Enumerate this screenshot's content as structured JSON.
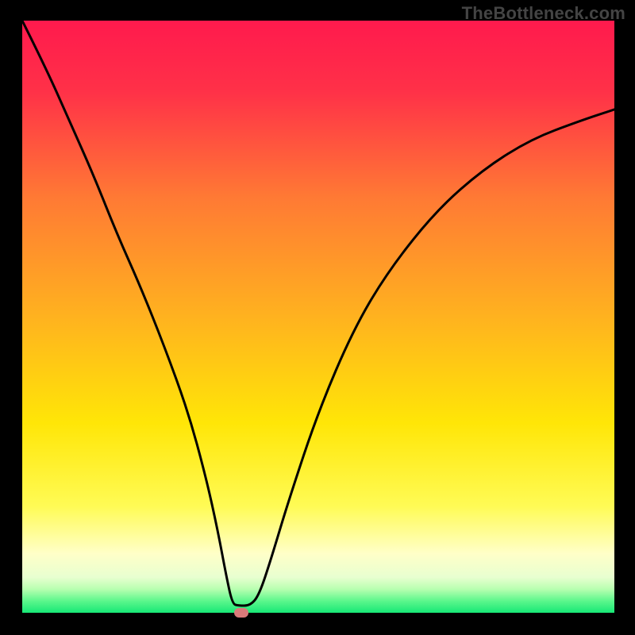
{
  "watermark": "TheBottleneck.com",
  "chart_data": {
    "type": "line",
    "title": "",
    "xlabel": "",
    "ylabel": "",
    "xlim": [
      0,
      100
    ],
    "ylim": [
      0,
      100
    ],
    "background_gradient_stops": [
      {
        "pct": 0,
        "color": "#ff1a4d"
      },
      {
        "pct": 12,
        "color": "#ff3148"
      },
      {
        "pct": 30,
        "color": "#ff7a34"
      },
      {
        "pct": 50,
        "color": "#ffb21f"
      },
      {
        "pct": 68,
        "color": "#ffe607"
      },
      {
        "pct": 82,
        "color": "#fffb55"
      },
      {
        "pct": 90,
        "color": "#ffffc8"
      },
      {
        "pct": 94,
        "color": "#e8ffd0"
      },
      {
        "pct": 96,
        "color": "#b8ffb0"
      },
      {
        "pct": 98,
        "color": "#5cf78c"
      },
      {
        "pct": 100,
        "color": "#17e876"
      }
    ],
    "series": [
      {
        "name": "curve",
        "x": [
          0,
          4,
          8,
          12,
          16,
          20,
          24,
          28,
          31,
          33,
          34.5,
          35.5,
          36.5,
          38.5,
          40,
          42,
          45,
          50,
          56,
          62,
          70,
          78,
          86,
          94,
          100
        ],
        "y": [
          100,
          92,
          83,
          74,
          64,
          55,
          45,
          34,
          23,
          14,
          6,
          1.5,
          1.2,
          1.2,
          3,
          9,
          19,
          34,
          48,
          58,
          68,
          75,
          80,
          83,
          85
        ]
      }
    ],
    "marker": {
      "x": 37,
      "y": 1.0,
      "color": "#d97a7a"
    }
  }
}
